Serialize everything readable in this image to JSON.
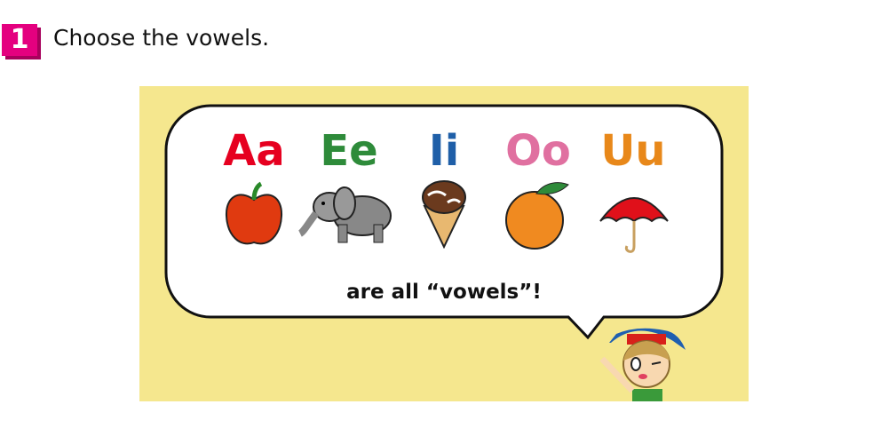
{
  "exercise": {
    "number": "1",
    "instruction": "Choose the vowels."
  },
  "vowels": [
    {
      "letter": "Aa",
      "color": "#e60020",
      "picture": "apple"
    },
    {
      "letter": "Ee",
      "color": "#2e8b3a",
      "picture": "elephant"
    },
    {
      "letter": "Ii",
      "color": "#1f5fa8",
      "picture": "ice-cream"
    },
    {
      "letter": "Oo",
      "color": "#e070a0",
      "picture": "orange"
    },
    {
      "letter": "Uu",
      "color": "#e8881a",
      "picture": "umbrella"
    }
  ],
  "caption": "are all “vowels”!"
}
